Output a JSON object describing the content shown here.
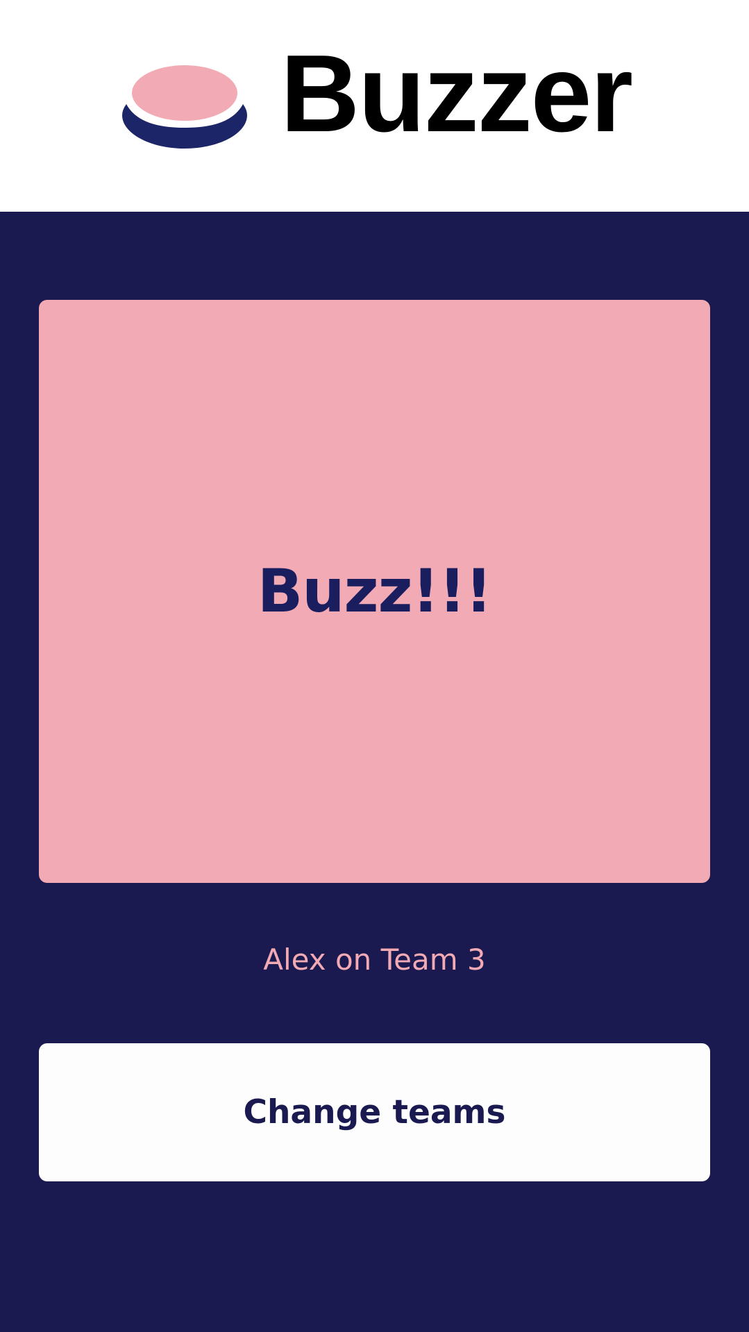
{
  "header": {
    "title": "Buzzer",
    "logo_icon": "buzzer-button-icon"
  },
  "main": {
    "buzz_label": "Buzz!!!",
    "player_info": "Alex on Team 3",
    "change_teams_label": "Change teams"
  },
  "colors": {
    "background": "#1a1a50",
    "header_background": "#ffffff",
    "accent_pink": "#f2aab4",
    "navy_text": "#1a1e5e",
    "button_white": "#fdfdfe"
  }
}
